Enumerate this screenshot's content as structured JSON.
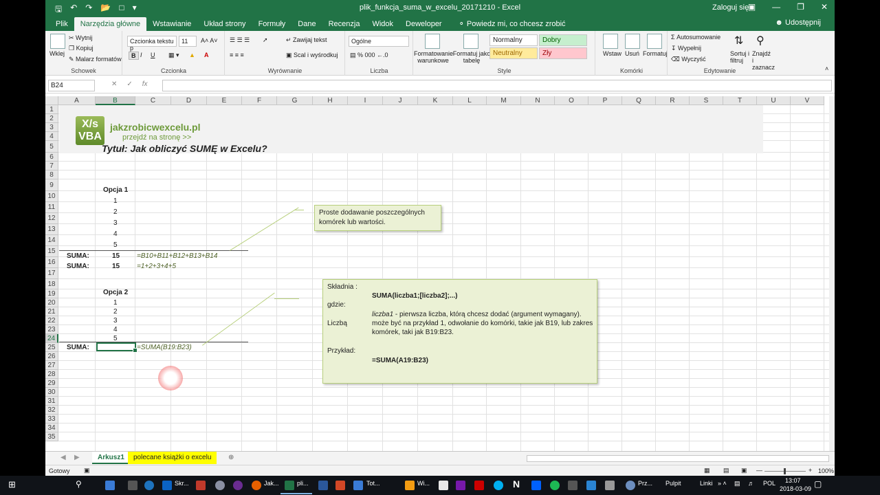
{
  "window": {
    "title": "plik_funkcja_suma_w_excelu_20171210  -  Excel",
    "user": "Zaloguj się",
    "share": "Udostępnij",
    "tell_me": "Powiedz mi, co chcesz zrobić"
  },
  "tabs": [
    "Plik",
    "Narzędzia główne",
    "Wstawianie",
    "Układ strony",
    "Formuły",
    "Dane",
    "Recenzja",
    "Widok",
    "Deweloper"
  ],
  "ribbon": {
    "clipboard": {
      "label": "Schowek",
      "paste": "Wklej",
      "cut": "Wytnij",
      "copy": "Kopiuj",
      "painter": "Malarz formatów"
    },
    "font": {
      "label": "Czcionka",
      "name": "Czcionka tekstu p",
      "size": "11",
      "bold": "B",
      "italic": "I",
      "underline": "U"
    },
    "alignment": {
      "label": "Wyrównanie",
      "wrap": "Zawijaj tekst",
      "merge": "Scal i wyśrodkuj"
    },
    "number": {
      "label": "Liczba",
      "format": "Ogólne"
    },
    "styles": {
      "label": "Style",
      "conditional": "Formatowanie warunkowe",
      "table": "Formatuj jako tabelę",
      "normal": "Normalny",
      "good": "Dobry",
      "neutral": "Neutralny",
      "bad": "Zły"
    },
    "cells": {
      "label": "Komórki",
      "insert": "Wstaw",
      "delete": "Usuń",
      "format": "Formatuj"
    },
    "editing": {
      "label": "Edytowanie",
      "autosum": "Autosumowanie",
      "fill": "Wypełnij",
      "clear": "Wyczyść",
      "sort": "Sortuj i filtruj",
      "find": "Znajdź i zaznacz"
    }
  },
  "formula_bar": {
    "name_box": "B24",
    "formula": ""
  },
  "columns": [
    "A",
    "B",
    "C",
    "D",
    "E",
    "F",
    "G",
    "H",
    "I",
    "J",
    "K",
    "L",
    "M",
    "N",
    "O",
    "P",
    "Q",
    "R",
    "S",
    "T",
    "U",
    "V"
  ],
  "rows": [
    "1",
    "2",
    "3",
    "4",
    "5",
    "6",
    "7",
    "8",
    "9",
    "10",
    "11",
    "12",
    "13",
    "14",
    "15",
    "16",
    "17",
    "18",
    "19",
    "20",
    "21",
    "22",
    "23",
    "24",
    "25",
    "26",
    "27",
    "28",
    "29",
    "30",
    "31",
    "32",
    "33",
    "34",
    "35"
  ],
  "banner": {
    "logo_top": "X/s",
    "logo_bottom": "VBA",
    "site": "jakzrobicwexcelu.pl",
    "link": "przejdź na stronę >>",
    "title": "Tytuł: Jak obliczyć SUMĘ w Excelu?"
  },
  "sheet": {
    "opcja1": "Opcja 1",
    "opcja1_values": [
      "1",
      "2",
      "3",
      "4",
      "5"
    ],
    "suma_label": "SUMA:",
    "sum1": "15",
    "sum2": "15",
    "formula1": "=B10+B11+B12+B13+B14",
    "formula2": "=1+2+3+4+5",
    "opcja2": "Opcja 2",
    "opcja2_values": [
      "1",
      "2",
      "3",
      "4",
      "5"
    ],
    "formula3": "=SUMA(B19:B23)"
  },
  "callout1": {
    "text": "Proste dodawanie poszczególnych komórek lub wartości."
  },
  "callout2": {
    "syntax_label": "Składnia :",
    "syntax": "SUMA(liczba1;[liczba2];...)",
    "where": "gdzie:",
    "arg_name": "liczba1",
    "arg_desc": " - pierwsza liczba, którą chcesz dodać (argument wymagany).",
    "liczba_label": "Liczbą",
    "arg_desc2": "może być na przykład 1, odwołanie do komórki, takie jak B19, lub zakres komórek, taki jak B19:B23.",
    "example_label": "Przykład:",
    "example": "=SUMA(A19:B23)"
  },
  "sheet_tabs": [
    "Arkusz1",
    "polecane książki o excelu"
  ],
  "status": {
    "ready": "Gotowy",
    "zoom": "100%"
  },
  "taskbar": {
    "items": [
      "Skr...",
      "Jak...",
      "pli...",
      "Tot...",
      "Wi...",
      "Prz..."
    ],
    "pulpit": "Pulpit",
    "linki": "Linki",
    "lang": "POL",
    "time": "13:07",
    "date": "2018-03-09"
  }
}
